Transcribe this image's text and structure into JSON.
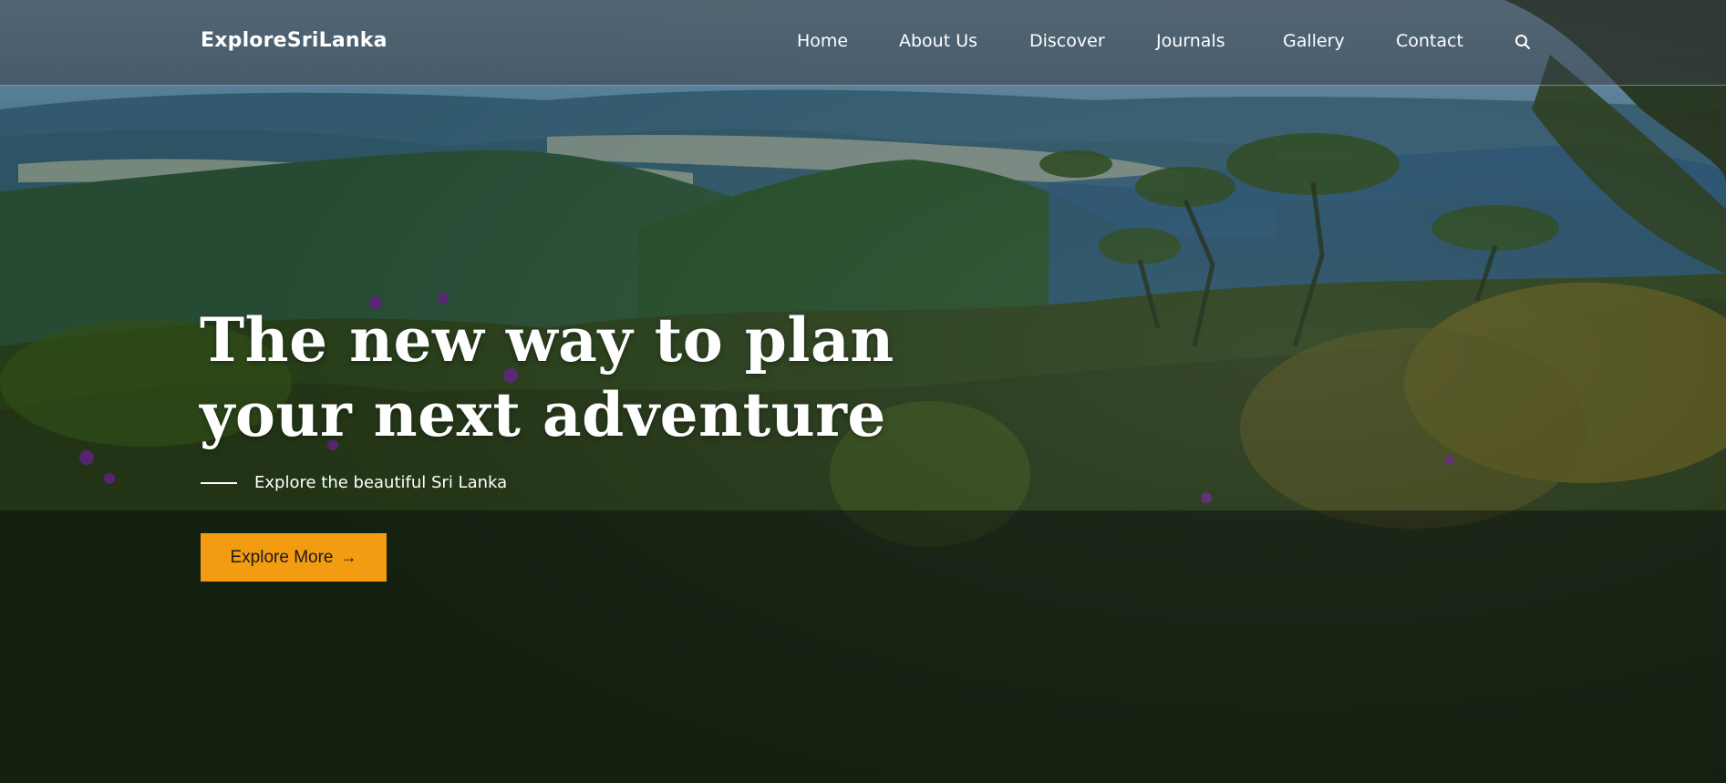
{
  "header": {
    "brand": "ExploreSriLanka",
    "nav": [
      {
        "label": "Home"
      },
      {
        "label": "About Us"
      },
      {
        "label": "Discover"
      },
      {
        "label": "Journals"
      },
      {
        "label": "Gallery"
      },
      {
        "label": "Contact"
      }
    ],
    "search_icon": "search-icon"
  },
  "hero": {
    "headline_line1": "The new way to plan",
    "headline_line2": "your next adventure",
    "subtitle": "Explore the beautiful Sri Lanka",
    "cta_label": "Explore More",
    "cta_icon": "arrow-right-icon",
    "cta_color": "#f39c12"
  }
}
